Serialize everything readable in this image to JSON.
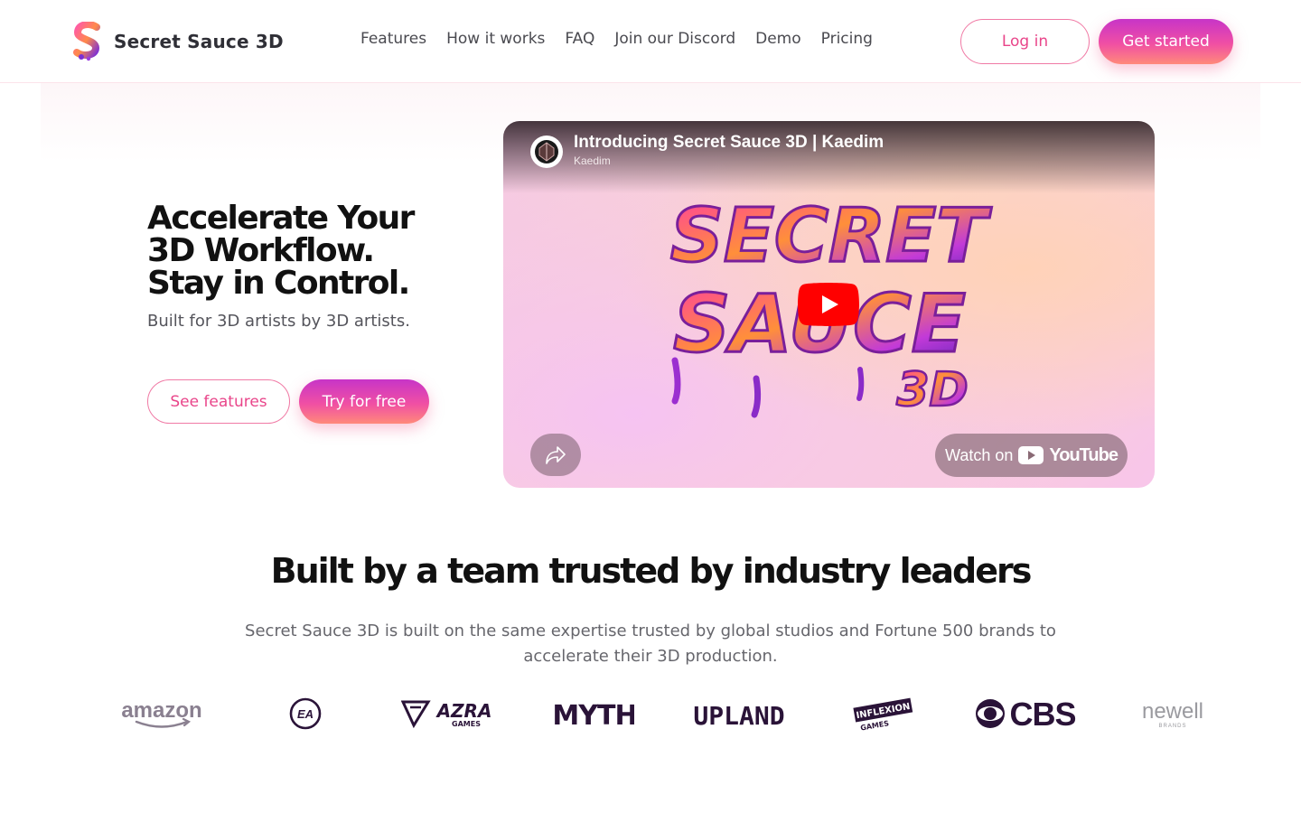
{
  "brand": {
    "name": "Secret Sauce 3D",
    "logo_icon": "s-logo-icon"
  },
  "nav": {
    "items": [
      {
        "label": "Features"
      },
      {
        "label": "How it works"
      },
      {
        "label": "FAQ"
      },
      {
        "label": "Join our Discord"
      },
      {
        "label": "Demo"
      },
      {
        "label": "Pricing"
      }
    ],
    "login_label": "Log in",
    "get_started_label": "Get started"
  },
  "hero": {
    "title": "Accelerate Your 3D Workflow. Stay in Control.",
    "subtitle": "Built for 3D artists by 3D artists.",
    "see_features_label": "See features",
    "try_free_label": "Try for free"
  },
  "video": {
    "title": "Introducing Secret Sauce 3D | Kaedim",
    "channel": "Kaedim",
    "watch_on_label": "Watch on",
    "platform_name": "YouTube",
    "art_text": {
      "line1": "SECRET",
      "line2": "SAUCE",
      "line3": "3D"
    }
  },
  "trusted": {
    "title": "Built by a team trusted by industry leaders",
    "description": "Secret Sauce 3D is built on the same expertise trusted by global studios and Fortune 500 brands to accelerate their 3D production.",
    "logos": [
      {
        "text": "amazon"
      },
      {
        "text": "EA"
      },
      {
        "text": "AZRA",
        "sub": "GAMES"
      },
      {
        "text": "MYTH"
      },
      {
        "text": "UPLAND"
      },
      {
        "text": "INFLEXION",
        "sub": "GAMES"
      },
      {
        "text": "CBS"
      },
      {
        "text": "newell",
        "sub": "BRANDS"
      }
    ]
  },
  "colors": {
    "accent_pink": "#e9458a",
    "gradient_start": "#c734c8",
    "gradient_end": "#ff8a7a",
    "logo_purple": "#2a1338"
  }
}
